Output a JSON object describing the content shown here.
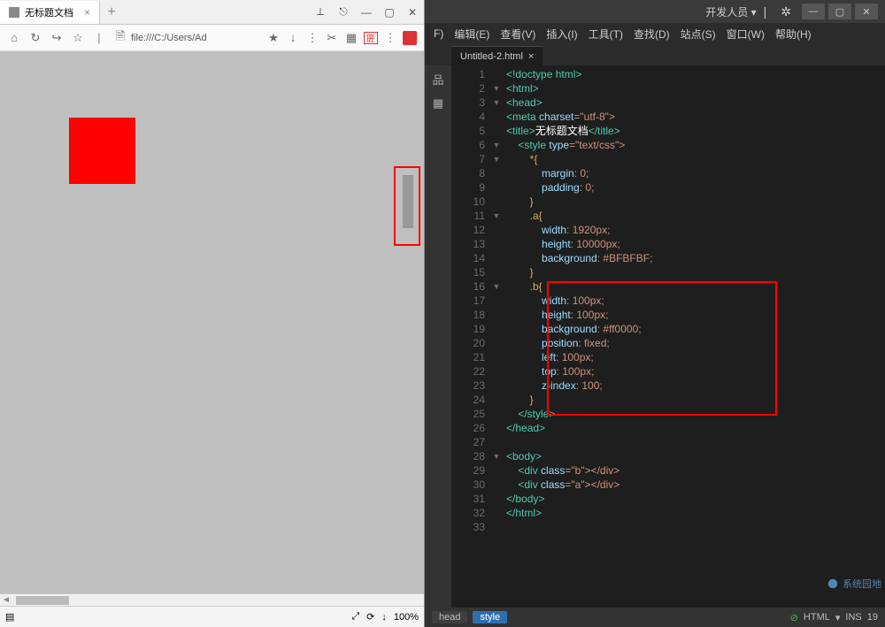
{
  "browser": {
    "tab_title": "无标题文档",
    "new_tab": "+",
    "win_icons": [
      "⟂",
      "—",
      "▢",
      "✕"
    ],
    "addr_prefix_icons": [
      "⌂",
      "↻",
      "↪",
      "☆"
    ],
    "url_icon": "🗎",
    "url": "file:///C:/Users/Ad",
    "right_icons": [
      "★",
      "↓",
      "⋮",
      "✂",
      "▦"
    ],
    "extra_sym": "匥",
    "status_icons": [
      "▤",
      "⤢",
      "⟳",
      "↓"
    ],
    "zoom": "100%",
    "win_extra": "⎋"
  },
  "ide": {
    "title_menu": "开发人员 ▾",
    "menus": [
      "F)",
      "编辑(E)",
      "查看(V)",
      "插入(I)",
      "工具(T)",
      "查找(D)",
      "站点(S)",
      "窗口(W)",
      "帮助(H)"
    ],
    "file_tab": "Untitled-2.html",
    "tab_close": "×",
    "side_labels": [
      "品",
      "▦"
    ],
    "crumbs": {
      "head": "head",
      "style": "style"
    },
    "status": {
      "lang": "HTML",
      "ins": "INS",
      "pos": "19"
    },
    "watermark": "系统园地",
    "code": {
      "l1": "<!doctype html>",
      "l2": "<html>",
      "l3": "<head>",
      "l4_a": "<meta ",
      "l4_b": "charset",
      "l4_c": "=\"utf-8\">",
      "l5_a": "<title>",
      "l5_b": "无标题文档",
      "l5_c": "</title>",
      "l6_a": "<style ",
      "l6_b": "type",
      "l6_c": "=\"text/css\">",
      "l7": "*{",
      "l8_a": "margin",
      "l8_b": ": 0;",
      "l9_a": "padding",
      "l9_b": ": 0;",
      "l10": "}",
      "l11": ".a{",
      "l12_a": "width",
      "l12_b": ": 1920px;",
      "l13_a": "height",
      "l13_b": ": 10000px;",
      "l14_a": "background",
      "l14_b": ": #BFBFBF;",
      "l15": "}",
      "l16": ".b{",
      "l17_a": "width",
      "l17_b": ": 100px;",
      "l18_a": "height",
      "l18_b": ": 100px;",
      "l19_a": "background",
      "l19_b": ": #ff0000;",
      "l20_a": "position",
      "l20_b": ": fixed;",
      "l21_a": "left",
      "l21_b": ": 100px;",
      "l22_a": "top",
      "l22_b": ": 100px;",
      "l23_a": "z-index",
      "l23_b": ": 100;",
      "l24": "}",
      "l25": "</style>",
      "l26": "</head>",
      "l27": "",
      "l28": "<body>",
      "l29_a": "<div ",
      "l29_b": "class",
      "l29_c": "=\"b\"></div>",
      "l30_a": "<div ",
      "l30_b": "class",
      "l30_c": "=\"a\"></div>",
      "l31": "</body>",
      "l32": "</html>"
    },
    "line_numbers": [
      "1",
      "2",
      "3",
      "4",
      "5",
      "6",
      "7",
      "8",
      "9",
      "10",
      "11",
      "12",
      "13",
      "14",
      "15",
      "16",
      "17",
      "18",
      "19",
      "20",
      "21",
      "22",
      "23",
      "24",
      "25",
      "26",
      "27",
      "28",
      "29",
      "30",
      "31",
      "32",
      "33"
    ],
    "fold_markers": [
      "",
      "▼",
      "▼",
      "",
      "",
      "▼",
      "▼",
      "",
      "",
      "",
      "▼",
      "",
      "",
      "",
      "",
      "▼",
      "",
      "",
      "",
      "",
      "",
      "",
      "",
      "",
      "",
      "",
      "",
      "▼",
      "",
      "",
      "",
      "",
      ""
    ]
  }
}
